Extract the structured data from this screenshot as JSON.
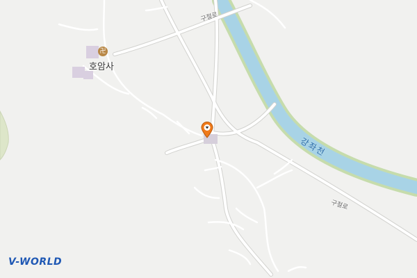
{
  "map": {
    "labels": {
      "temple": "호암사",
      "road_upper": "구절로",
      "road_lower": "구절로",
      "river": "강좌천"
    },
    "icons": {
      "temple_icon": "buddhist-temple-icon",
      "temple_glyph": "卍",
      "location_marker": "map-pin-icon"
    },
    "colors": {
      "background": "#f1f1ef",
      "road": "#ffffff",
      "river": "#a8d3e6",
      "river_bank": "#c6dcac",
      "marker": "#f07a1a",
      "temple_area": "#d9cfe0",
      "logo": "#1f58b4"
    }
  },
  "branding": {
    "logo_text": "V-WORLD"
  }
}
